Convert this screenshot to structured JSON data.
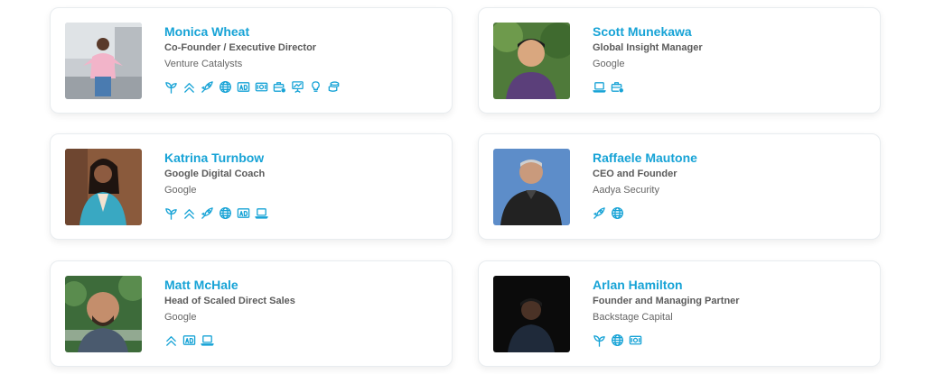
{
  "accent_color": "#17a3d6",
  "people": [
    {
      "name": "Monica Wheat",
      "title": "Co-Founder / Executive Director",
      "company": "Venture Catalysts",
      "icons": [
        "sprout-icon",
        "chevrons-up-icon",
        "rocket-icon",
        "globe-icon",
        "ad-icon",
        "money-icon",
        "briefcase-icon",
        "presentation-icon",
        "lightbulb-icon",
        "coins-icon"
      ]
    },
    {
      "name": "Scott Munekawa",
      "title": "Global Insight Manager",
      "company": "Google",
      "icons": [
        "laptop-icon",
        "briefcase-icon"
      ]
    },
    {
      "name": "Katrina Turnbow",
      "title": "Google Digital Coach",
      "company": "Google",
      "icons": [
        "sprout-icon",
        "chevrons-up-icon",
        "rocket-icon",
        "globe-icon",
        "ad-icon",
        "laptop-icon"
      ]
    },
    {
      "name": "Raffaele Mautone",
      "title": "CEO and Founder",
      "company": "Aadya Security",
      "icons": [
        "rocket-icon",
        "globe-icon"
      ]
    },
    {
      "name": "Matt McHale",
      "title": "Head of Scaled Direct Sales",
      "company": "Google",
      "icons": [
        "chevrons-up-icon",
        "ad-icon",
        "laptop-icon"
      ]
    },
    {
      "name": "Arlan Hamilton",
      "title": "Founder and Managing Partner",
      "company": "Backstage Capital",
      "icons": [
        "sprout-icon",
        "globe-icon",
        "money-icon"
      ]
    }
  ]
}
